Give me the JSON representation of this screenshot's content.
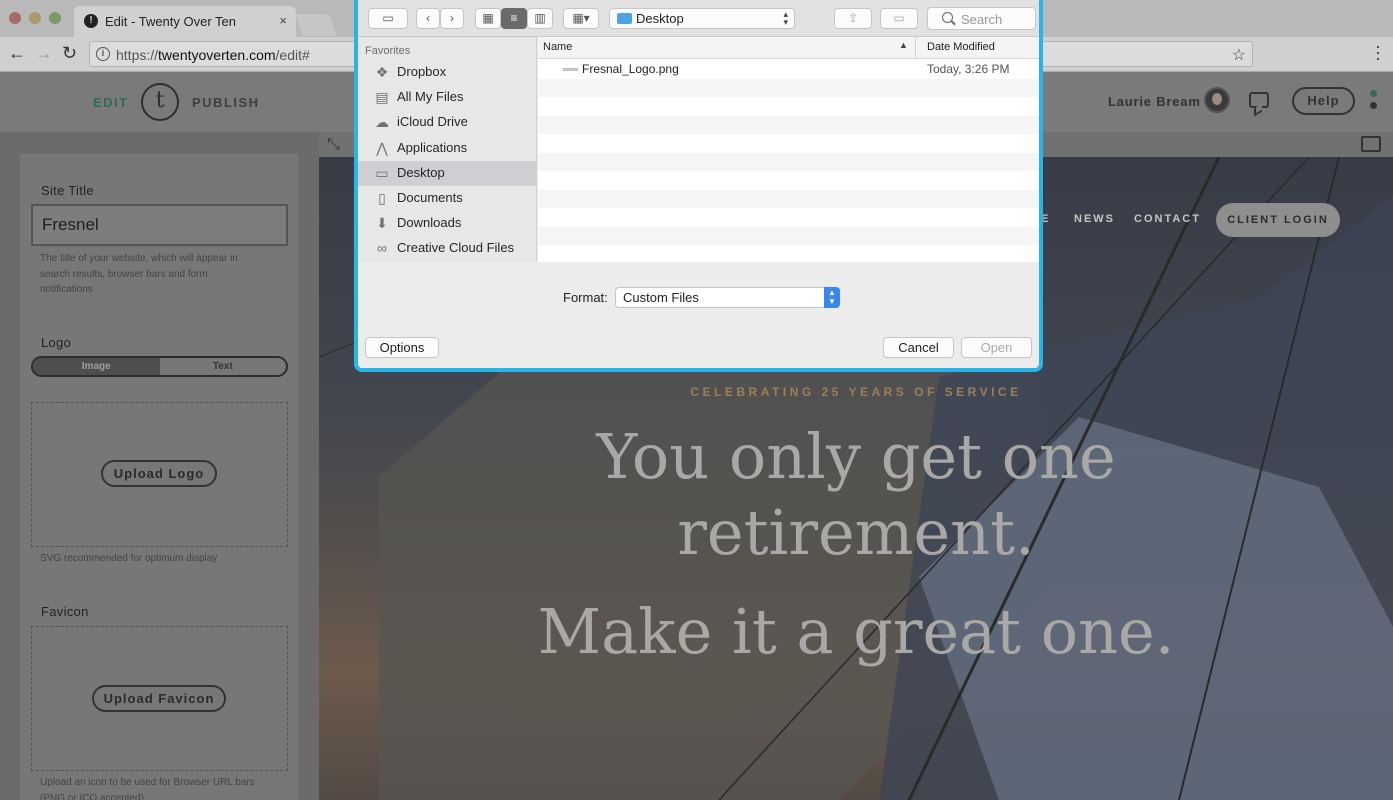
{
  "browser": {
    "tab_title": "Edit - Twenty Over Ten",
    "tab_favicon": "!",
    "tab_close": "×",
    "url_prefix": "https://",
    "url_host": "twentyoverten.com",
    "url_path": "/edit#",
    "back": "←",
    "forward": "→",
    "reload": "↻",
    "info": "i",
    "bookmark": "☆"
  },
  "header": {
    "edit": "EDIT",
    "logo_letter": "t",
    "publish": "PUBLISH",
    "user_name": "Laurie Bream",
    "help": "Help"
  },
  "panel": {
    "site_title_label": "Site Title",
    "site_title_value": "Fresnel",
    "site_title_hint_1": "The title of your website, which will appear in",
    "site_title_hint_2": "search results, browser bars and form",
    "site_title_hint_3": "notifications",
    "logo_label": "Logo",
    "logo_tab_image": "Image",
    "logo_tab_text": "Text",
    "upload_logo": "Upload Logo",
    "logo_hint": "SVG recommended for optimum display",
    "favicon_label": "Favicon",
    "upload_favicon": "Upload Favicon",
    "favicon_hint_1": "Upload an icon to be used for Browser URL bars",
    "favicon_hint_2": "(PNG or ICO accepted)"
  },
  "preview": {
    "nav_partial": "E",
    "nav_news": "NEWS",
    "nav_contact": "CONTACT",
    "client_login": "CLIENT LOGIN",
    "kicker": "CELEBRATING 25 YEARS OF SERVICE",
    "headline_1": "You only get one",
    "headline_2": "retirement.",
    "headline_3": "Make it a great one."
  },
  "dialog": {
    "location": "Desktop",
    "search_placeholder": "Search",
    "sidebar_heading": "Favorites",
    "sidebar_items": [
      {
        "label": "Dropbox",
        "icon": "dropbox-icon"
      },
      {
        "label": "All My Files",
        "icon": "all-files-icon"
      },
      {
        "label": "iCloud Drive",
        "icon": "cloud-icon"
      },
      {
        "label": "Applications",
        "icon": "applications-icon"
      },
      {
        "label": "Desktop",
        "icon": "desktop-icon",
        "selected": true
      },
      {
        "label": "Documents",
        "icon": "documents-icon"
      },
      {
        "label": "Downloads",
        "icon": "downloads-icon"
      },
      {
        "label": "Creative Cloud Files",
        "icon": "creative-cloud-icon"
      }
    ],
    "columns": {
      "name": "Name",
      "date": "Date Modified"
    },
    "files": [
      {
        "name": "Fresnal_Logo.png",
        "date": "Today, 3:26 PM"
      }
    ],
    "format_label": "Format:",
    "format_value": "Custom Files",
    "options": "Options",
    "cancel": "Cancel",
    "open": "Open"
  },
  "colors": {
    "dialog_border": "#27b4e8",
    "accent_green": "#2f6b5a",
    "kicker_gold": "#9a8057"
  }
}
